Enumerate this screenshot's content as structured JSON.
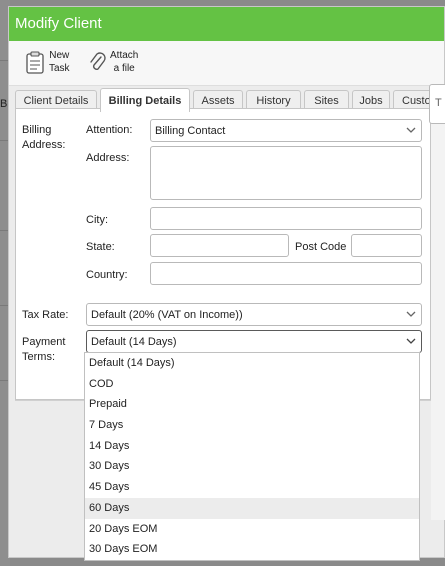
{
  "window": {
    "title": "Modify Client"
  },
  "background": {
    "edge_glyph": "B"
  },
  "toolbar": {
    "new_task_line1": "New",
    "new_task_line2": "Task",
    "attach_line1": "Attach",
    "attach_line2": "a file"
  },
  "tabs": [
    {
      "label": "Client Details"
    },
    {
      "label": "Billing Details"
    },
    {
      "label": "Assets"
    },
    {
      "label": "History"
    },
    {
      "label": "Sites"
    },
    {
      "label": "Jobs"
    },
    {
      "label": "Custom"
    }
  ],
  "side_field": {
    "glyph": "T"
  },
  "billing": {
    "section_label_line1": "Billing",
    "section_label_line2": "Address:",
    "attention_label": "Attention:",
    "attention_value": "Billing Contact",
    "address_label": "Address:",
    "address_value": "",
    "city_label": "City:",
    "city_value": "",
    "state_label": "State:",
    "state_value": "",
    "postcode_label": "Post Code",
    "postcode_value": "",
    "country_label": "Country:",
    "country_value": ""
  },
  "tax": {
    "label": "Tax Rate:",
    "value": "Default (20% (VAT on Income))"
  },
  "payment": {
    "label_line1": "Payment",
    "label_line2": "Terms:",
    "value": "Default (14 Days)",
    "options": [
      "Default (14 Days)",
      "COD",
      "Prepaid",
      "7 Days",
      "14 Days",
      "30 Days",
      "45 Days",
      "60 Days",
      "20 Days EOM",
      "30 Days EOM"
    ],
    "highlighted_option": "60 Days"
  },
  "colors": {
    "titlebar": "#64c244",
    "highlight": "#ececec"
  }
}
